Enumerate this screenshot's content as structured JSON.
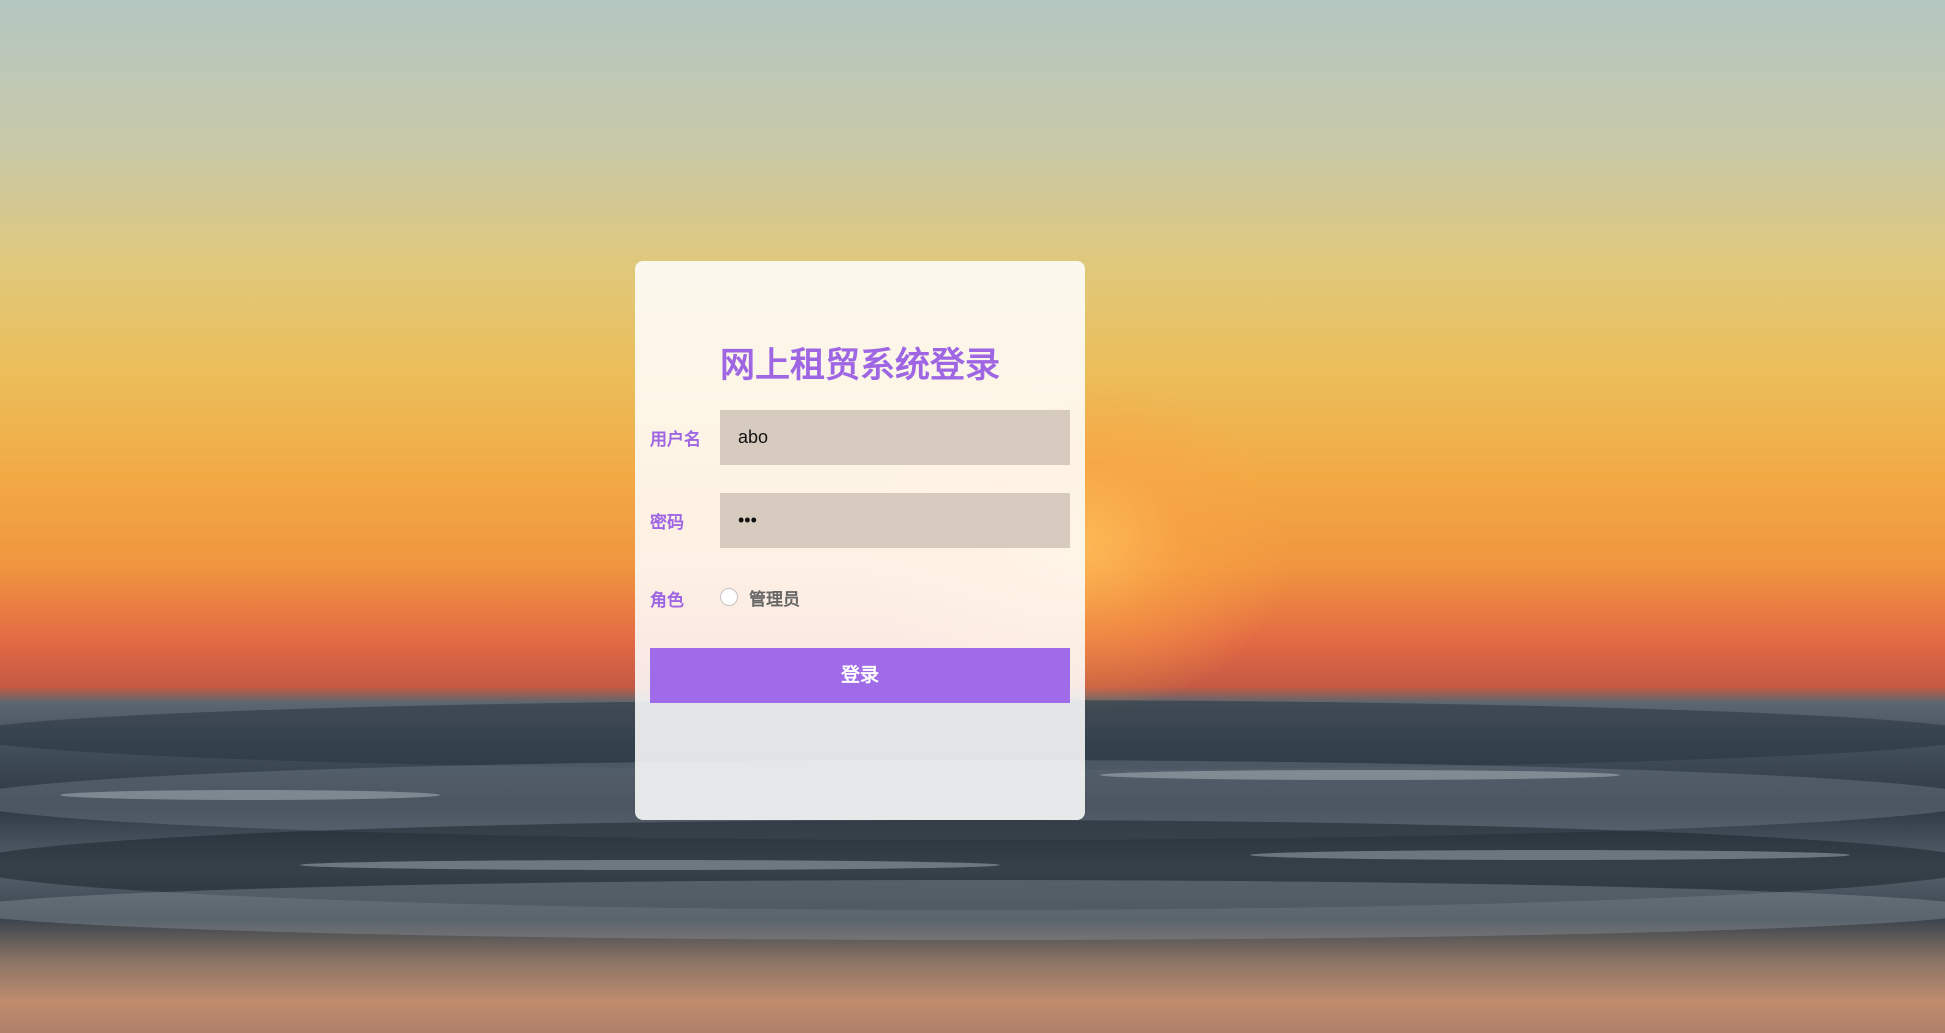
{
  "login": {
    "title": "网上租贸系统登录",
    "username_label": "用户名",
    "username_value": "abo",
    "password_label": "密码",
    "password_value": "•••",
    "role_label": "角色",
    "role_option": "管理员",
    "submit_label": "登录"
  },
  "colors": {
    "accent": "#9f66e4",
    "button": "#9f6be8",
    "input_bg": "#d7cbbf"
  }
}
